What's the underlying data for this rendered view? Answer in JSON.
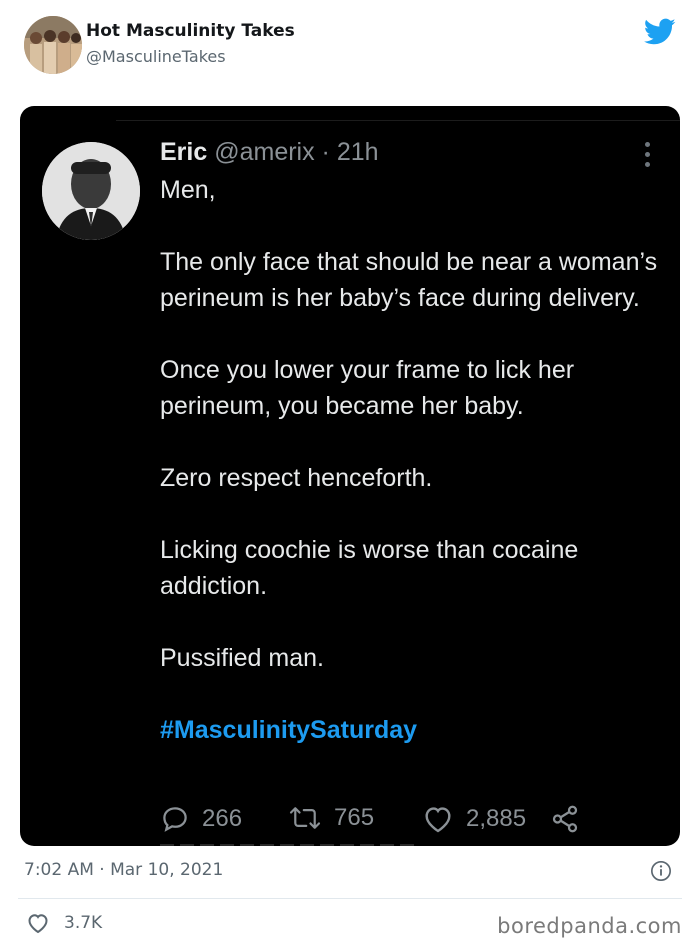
{
  "account": {
    "display_name": "Hot Masculinity Takes",
    "handle": "@MasculineTakes",
    "logo_icon": "twitter-bird-icon",
    "brand_color": "#1da1f2"
  },
  "embedded_tweet": {
    "author_name": "Eric",
    "author_handle": "@amerix",
    "time_ago": " · 21h",
    "paragraphs": [
      "Men,",
      "The only face that should be near a woman’s perineum is her baby’s face during delivery.",
      "Once you lower your frame to lick her perineum, you became her baby.",
      "Zero respect henceforth.",
      "Licking coochie is worse than cocaine addiction.",
      "Pussified man."
    ],
    "hashtag": "#MasculinitySaturday",
    "hashtag_color": "#1d9bf0",
    "replies": "266",
    "retweets": "765",
    "likes": "2,885",
    "background": "#000000"
  },
  "footer": {
    "timestamp": "7:02 AM · Mar 10, 2021",
    "like_count": "3.7K",
    "watermark": "boredpanda.com"
  }
}
